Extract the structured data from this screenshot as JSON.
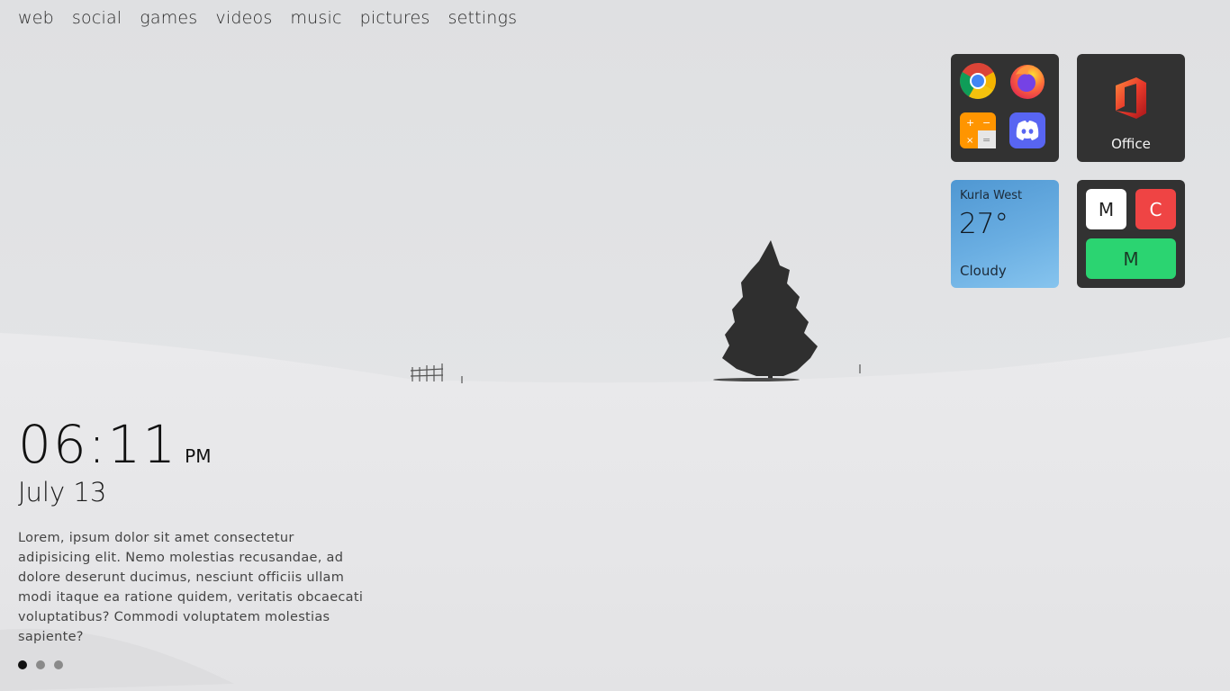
{
  "nav": {
    "items": [
      {
        "label": "web"
      },
      {
        "label": "social"
      },
      {
        "label": "games"
      },
      {
        "label": "videos"
      },
      {
        "label": "music"
      },
      {
        "label": "pictures"
      },
      {
        "label": "settings"
      }
    ]
  },
  "apps_tile": {
    "apps": [
      {
        "icon": "chrome-icon"
      },
      {
        "icon": "firefox-icon"
      },
      {
        "icon": "calculator-icon"
      },
      {
        "icon": "discord-icon"
      }
    ]
  },
  "office_tile": {
    "label": "Office",
    "icon": "office-icon"
  },
  "weather": {
    "location": "Kurla West",
    "temperature": "27°",
    "condition": "Cloudy"
  },
  "letters_tile": {
    "buttons": [
      {
        "label": "M"
      },
      {
        "label": "C"
      },
      {
        "label": "M"
      }
    ]
  },
  "clock": {
    "time": "06:11",
    "ampm": "PM",
    "date": "July 13"
  },
  "description": "Lorem, ipsum dolor sit amet consectetur adipisicing elit. Nemo molestias recusandae, ad dolore deserunt ducimus, nesciunt officiis ullam modi itaque ea ratione quidem, veritatis obcaecati voluptatibus? Commodi voluptatem molestias sapiente?",
  "pagination": {
    "count": 3,
    "active": 1
  },
  "colors": {
    "tile_dark": "#323232",
    "weather_blue": "#5ba3dc",
    "red": "#ef4444",
    "green": "#2bd471"
  }
}
